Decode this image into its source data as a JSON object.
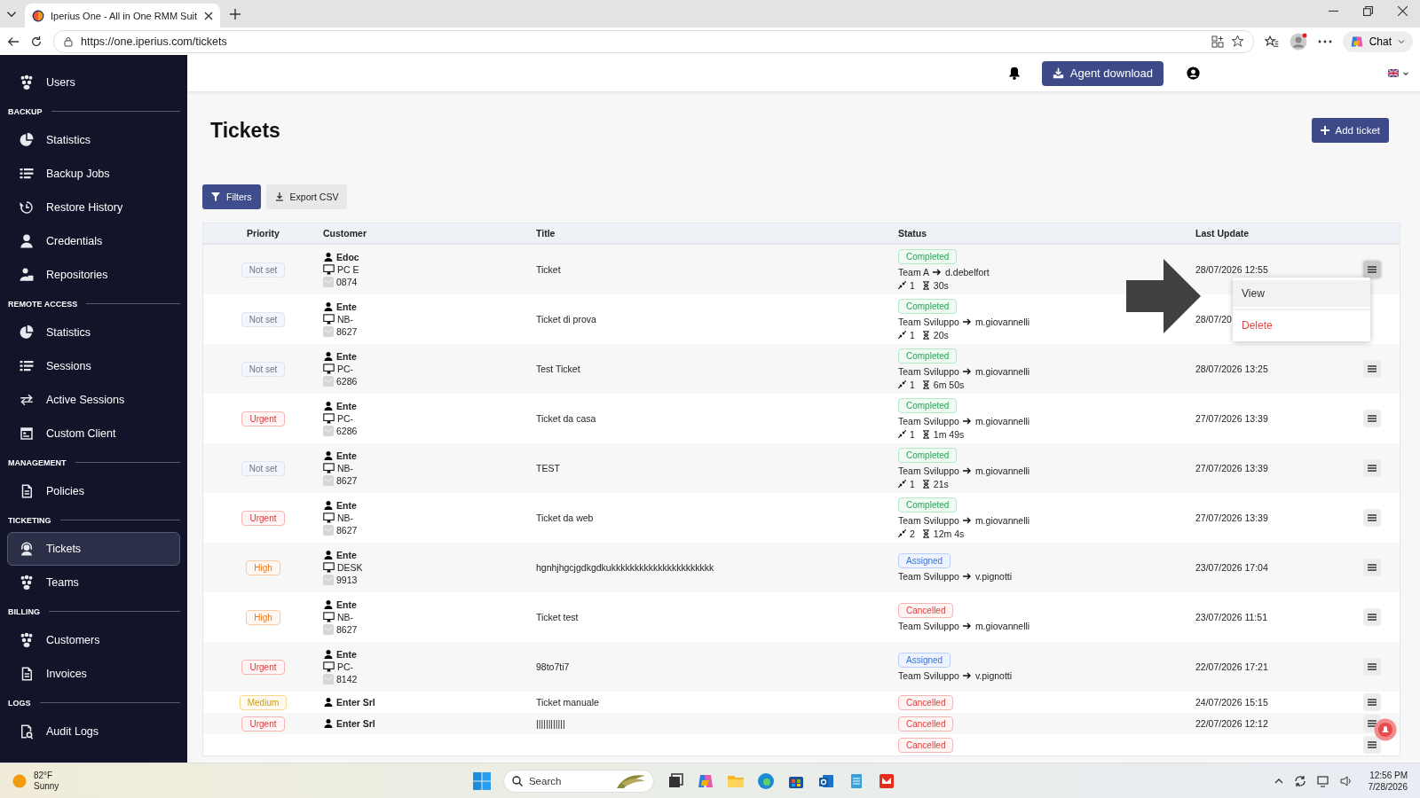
{
  "browser": {
    "tab_title": "Iperius One - All in One RMM Suit",
    "url": "https://one.iperius.com/tickets",
    "chat_label": "Chat"
  },
  "sidebar": {
    "items": [
      {
        "label": "Users",
        "selected": false
      }
    ],
    "sections": [
      {
        "heading": "BACKUP",
        "items": [
          {
            "label": "Statistics",
            "selected": false
          },
          {
            "label": "Backup Jobs",
            "selected": false
          },
          {
            "label": "Restore History",
            "selected": false
          },
          {
            "label": "Credentials",
            "selected": false
          },
          {
            "label": "Repositories",
            "selected": false
          }
        ]
      },
      {
        "heading": "REMOTE ACCESS",
        "items": [
          {
            "label": "Statistics",
            "selected": false
          },
          {
            "label": "Sessions",
            "selected": false
          },
          {
            "label": "Active Sessions",
            "selected": false
          },
          {
            "label": "Custom Client",
            "selected": false
          }
        ]
      },
      {
        "heading": "MANAGEMENT",
        "items": [
          {
            "label": "Policies",
            "selected": false
          }
        ]
      },
      {
        "heading": "TICKETING",
        "items": [
          {
            "label": "Tickets",
            "selected": true
          },
          {
            "label": "Teams",
            "selected": false
          }
        ]
      },
      {
        "heading": "BILLING",
        "items": [
          {
            "label": "Customers",
            "selected": false
          },
          {
            "label": "Invoices",
            "selected": false
          }
        ]
      },
      {
        "heading": "LOGS",
        "items": [
          {
            "label": "Audit Logs",
            "selected": false
          }
        ]
      }
    ]
  },
  "header": {
    "agent_button": "Agent download"
  },
  "page": {
    "title": "Tickets",
    "add_button": "Add ticket",
    "filters_button": "Filters",
    "export_button": "Export CSV"
  },
  "table": {
    "columns": [
      "Priority",
      "Customer",
      "Title",
      "Status",
      "Last Update"
    ],
    "rows": [
      {
        "priority": {
          "label": "Not set",
          "kind": "none"
        },
        "customer": {
          "name": "Edoc",
          "device": "PC E",
          "code": "0874"
        },
        "title": "Ticket",
        "status": {
          "label": "Completed",
          "kind": "completed"
        },
        "team": "Team A",
        "assignee": "d.debelfort",
        "sessions": "1",
        "duration": "30s",
        "updated": "28/07/2026 12:55",
        "has_menu": true,
        "menu_open": true
      },
      {
        "priority": {
          "label": "Not set",
          "kind": "none"
        },
        "customer": {
          "name": "Ente",
          "device": "NB-",
          "code": "8627"
        },
        "title": "Ticket di prova",
        "status": {
          "label": "Completed",
          "kind": "completed"
        },
        "team": "Team Sviluppo",
        "assignee": "m.giovannelli",
        "sessions": "1",
        "duration": "20s",
        "updated": "28/07/20",
        "has_menu": false
      },
      {
        "priority": {
          "label": "Not set",
          "kind": "none"
        },
        "customer": {
          "name": "Ente",
          "device": "PC-",
          "code": "6286"
        },
        "title": "Test Ticket",
        "status": {
          "label": "Completed",
          "kind": "completed"
        },
        "team": "Team Sviluppo",
        "assignee": "m.giovannelli",
        "sessions": "1",
        "duration": "6m 50s",
        "updated": "28/07/2026 13:25",
        "has_menu": true,
        "menu_open": false
      },
      {
        "priority": {
          "label": "Urgent",
          "kind": "urgent"
        },
        "customer": {
          "name": "Ente",
          "device": "PC-",
          "code": "6286"
        },
        "title": "Ticket da casa",
        "status": {
          "label": "Completed",
          "kind": "completed"
        },
        "team": "Team Sviluppo",
        "assignee": "m.giovannelli",
        "sessions": "1",
        "duration": "1m 49s",
        "updated": "27/07/2026 13:39",
        "has_menu": true,
        "menu_open": false
      },
      {
        "priority": {
          "label": "Not set",
          "kind": "none"
        },
        "customer": {
          "name": "Ente",
          "device": "NB-",
          "code": "8627"
        },
        "title": "TEST",
        "status": {
          "label": "Completed",
          "kind": "completed"
        },
        "team": "Team Sviluppo",
        "assignee": "m.giovannelli",
        "sessions": "1",
        "duration": "21s",
        "updated": "27/07/2026 13:39",
        "has_menu": true,
        "menu_open": false
      },
      {
        "priority": {
          "label": "Urgent",
          "kind": "urgent"
        },
        "customer": {
          "name": "Ente",
          "device": "NB-",
          "code": "8627"
        },
        "title": "Ticket da web",
        "status": {
          "label": "Completed",
          "kind": "completed"
        },
        "team": "Team Sviluppo",
        "assignee": "m.giovannelli",
        "sessions": "2",
        "duration": "12m 4s",
        "updated": "27/07/2026 13:39",
        "has_menu": true,
        "menu_open": false
      },
      {
        "priority": {
          "label": "High",
          "kind": "high"
        },
        "customer": {
          "name": "Ente",
          "device": "DESK",
          "code": "9913"
        },
        "title": "hgnhjhgcjgdkgdkukkkkkkkkkkkkkkkkkkkkkk",
        "status": {
          "label": "Assigned",
          "kind": "assigned"
        },
        "team": "Team Sviluppo",
        "assignee": "v.pignotti",
        "updated": "23/07/2026 17:04",
        "has_menu": true,
        "menu_open": false
      },
      {
        "priority": {
          "label": "High",
          "kind": "high"
        },
        "customer": {
          "name": "Ente",
          "device": "NB-",
          "code": "8627"
        },
        "title": "Ticket test",
        "status": {
          "label": "Cancelled",
          "kind": "cancelled"
        },
        "team": "Team Sviluppo",
        "assignee": "m.giovannelli",
        "updated": "23/07/2026 11:51",
        "has_menu": true,
        "menu_open": false
      },
      {
        "priority": {
          "label": "Urgent",
          "kind": "urgent"
        },
        "customer": {
          "name": "Ente",
          "device": "PC-",
          "code": "8142"
        },
        "title": "98to7ti7",
        "status": {
          "label": "Assigned",
          "kind": "assigned"
        },
        "team": "Team Sviluppo",
        "assignee": "v.pignotti",
        "updated": "22/07/2026 17:21",
        "has_menu": true,
        "menu_open": false
      },
      {
        "priority": {
          "label": "Medium",
          "kind": "medium"
        },
        "customer": {
          "name": "Enter Srl"
        },
        "title": "Ticket manuale",
        "status": {
          "label": "Cancelled",
          "kind": "cancelled"
        },
        "updated": "24/07/2026 15:15",
        "has_menu": true,
        "menu_open": false
      },
      {
        "priority": {
          "label": "Urgent",
          "kind": "urgent"
        },
        "customer": {
          "name": "Enter Srl"
        },
        "title": "||||||||||||",
        "status": {
          "label": "Cancelled",
          "kind": "cancelled"
        },
        "updated": "22/07/2026 12:12",
        "has_menu": true,
        "menu_open": false
      },
      {
        "status": {
          "label": "Cancelled",
          "kind": "cancelled"
        },
        "has_menu": true,
        "menu_open": false
      }
    ]
  },
  "row_menu": {
    "items": [
      {
        "label": "View",
        "kind": "normal",
        "selected": true
      },
      {
        "label": "Delete",
        "kind": "danger",
        "selected": false
      }
    ]
  },
  "taskbar": {
    "temperature": "82°F",
    "weather": "Sunny",
    "search": {
      "placeholder": "Search"
    },
    "time": "12:56 PM",
    "date": "7/28/2026"
  }
}
